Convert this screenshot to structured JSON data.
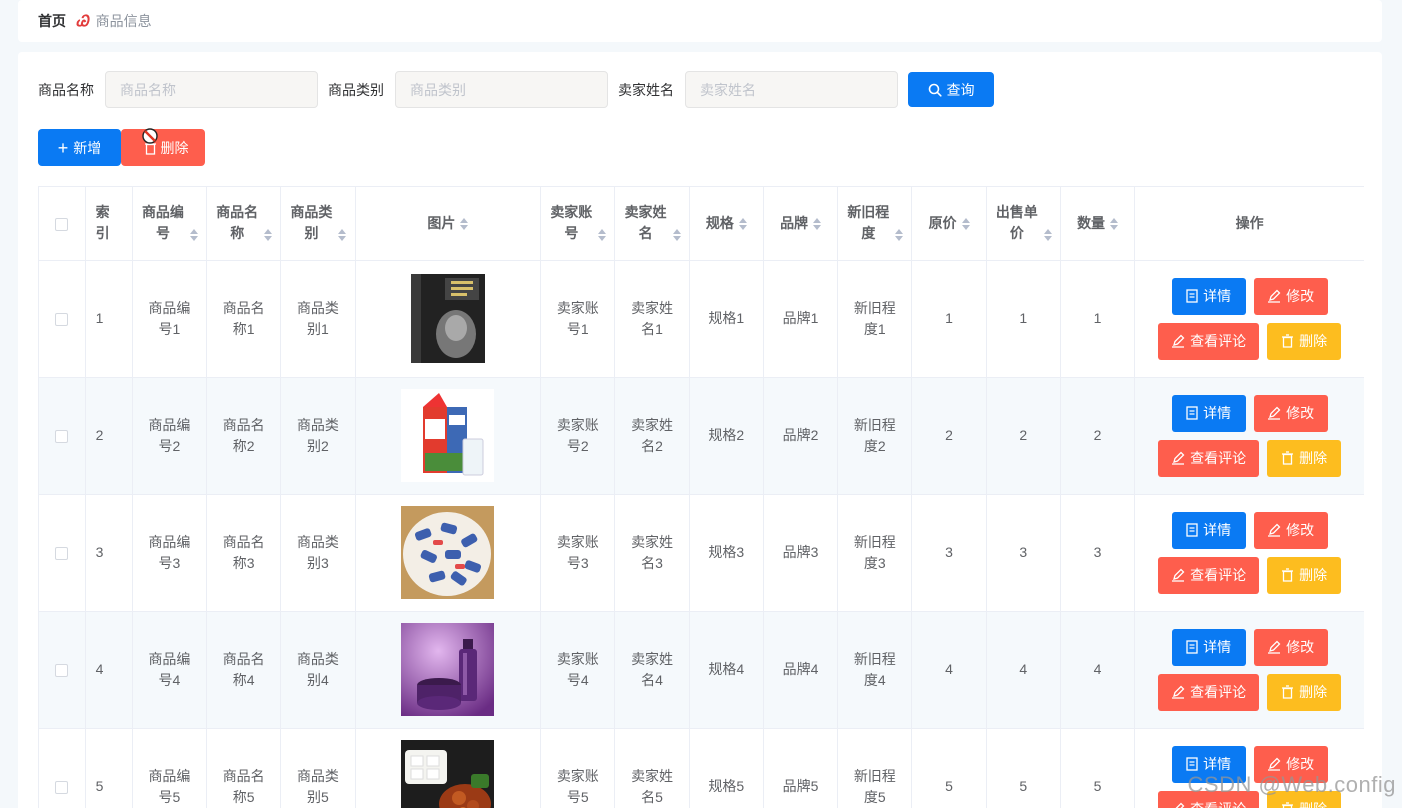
{
  "breadcrumb": {
    "home": "首页",
    "separator": "Ꮚ",
    "current": "商品信息"
  },
  "search": {
    "name_label": "商品名称",
    "name_placeholder": "商品名称",
    "category_label": "商品类别",
    "category_placeholder": "商品类别",
    "seller_label": "卖家姓名",
    "seller_placeholder": "卖家姓名",
    "query_button": "查询"
  },
  "toolbar": {
    "add_button": "新增",
    "delete_button": "删除"
  },
  "table": {
    "columns": [
      "索引",
      "商品编号",
      "商品名称",
      "商品类别",
      "图片",
      "卖家账号",
      "卖家姓名",
      "规格",
      "品牌",
      "新旧程度",
      "原价",
      "出售单价",
      "数量",
      "操作"
    ],
    "rows": [
      {
        "index": "1",
        "code": "商品编号1",
        "name": "商品名称1",
        "category": "商品类别1",
        "image": "book-cover",
        "account": "卖家账号1",
        "seller": "卖家姓名1",
        "spec": "规格1",
        "brand": "品牌1",
        "condition": "新旧程度1",
        "price": "1",
        "sale_price": "1",
        "qty": "1"
      },
      {
        "index": "2",
        "code": "商品编号2",
        "name": "商品名称2",
        "category": "商品类别2",
        "image": "milk-carton",
        "account": "卖家账号2",
        "seller": "卖家姓名2",
        "spec": "规格2",
        "brand": "品牌2",
        "condition": "新旧程度2",
        "price": "2",
        "sale_price": "2",
        "qty": "2"
      },
      {
        "index": "3",
        "code": "商品编号3",
        "name": "商品名称3",
        "category": "商品类别3",
        "image": "candy-plate",
        "account": "卖家账号3",
        "seller": "卖家姓名3",
        "spec": "规格3",
        "brand": "品牌3",
        "condition": "新旧程度3",
        "price": "3",
        "sale_price": "3",
        "qty": "3"
      },
      {
        "index": "4",
        "code": "商品编号4",
        "name": "商品名称4",
        "category": "商品类别4",
        "image": "cosmetics",
        "account": "卖家账号4",
        "seller": "卖家姓名4",
        "spec": "规格4",
        "brand": "品牌4",
        "condition": "新旧程度4",
        "price": "4",
        "sale_price": "4",
        "qty": "4"
      },
      {
        "index": "5",
        "code": "商品编号5",
        "name": "商品名称5",
        "category": "商品类别5",
        "image": "food-box",
        "account": "卖家账号5",
        "seller": "卖家姓名5",
        "spec": "规格5",
        "brand": "品牌5",
        "condition": "新旧程度5",
        "price": "5",
        "sale_price": "5",
        "qty": "5"
      }
    ],
    "row_actions": {
      "detail": "详情",
      "edit": "修改",
      "comment": "查看评论",
      "remove": "删除"
    }
  },
  "watermark": "CSDN @Web.config",
  "colors": {
    "primary": "#0a7af3",
    "danger": "#fe5e4d",
    "warning": "#fdbd1f"
  }
}
